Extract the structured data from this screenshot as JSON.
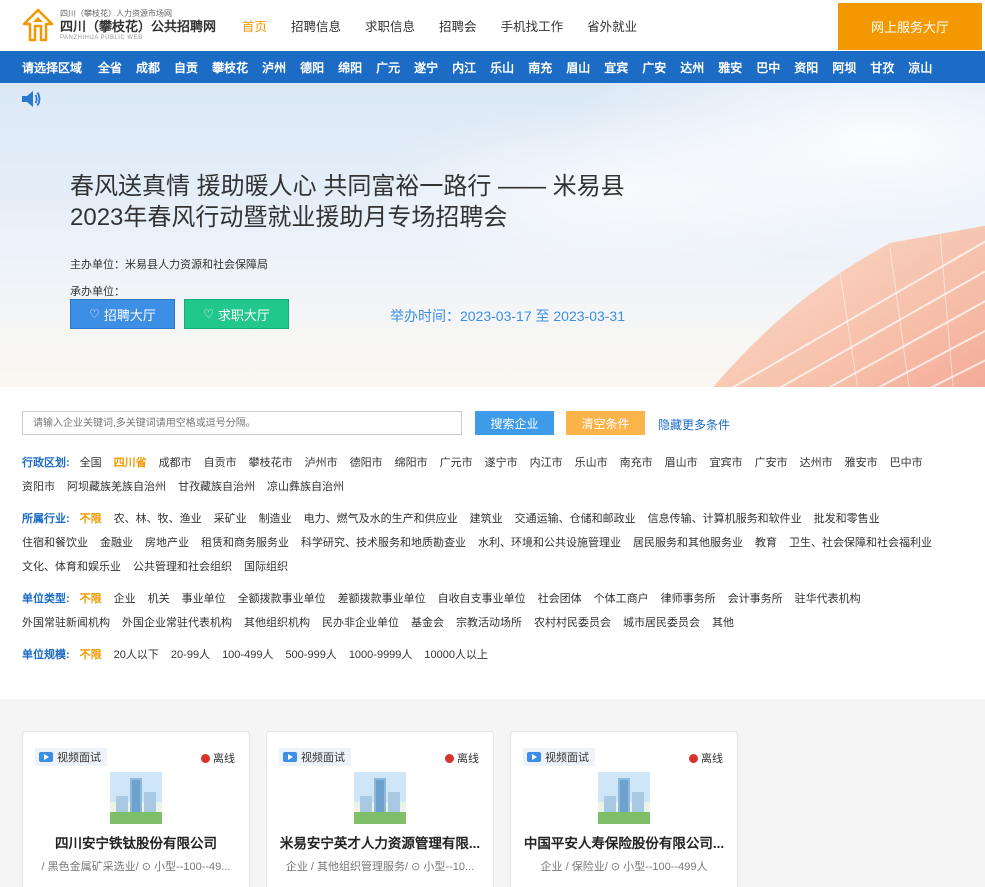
{
  "header": {
    "logo_small": "四川（攀枝花）人力资源市场网",
    "logo_main": "四川（攀枝花）公共招聘网",
    "logo_en": "PANZHIHUA PUBLIC WEB",
    "nav": [
      "首页",
      "招聘信息",
      "求职信息",
      "招聘会",
      "手机找工作",
      "省外就业"
    ],
    "hall_button": "网上服务大厅"
  },
  "regions": [
    "请选择区域",
    "全省",
    "成都",
    "自贡",
    "攀枝花",
    "泸州",
    "德阳",
    "绵阳",
    "广元",
    "遂宁",
    "内江",
    "乐山",
    "南充",
    "眉山",
    "宜宾",
    "广安",
    "达州",
    "雅安",
    "巴中",
    "资阳",
    "阿坝",
    "甘孜",
    "凉山"
  ],
  "banner": {
    "title_line1": "春风送真情 援助暖人心 共同富裕一路行 —— 米易县",
    "title_line2": "2023年春风行动暨就业援助月专场招聘会",
    "host": "主办单位：米易县人力资源和社会保障局",
    "cohost": "承办单位：",
    "recruit_hall": "招聘大厅",
    "job_hall": "求职大厅",
    "time": "举办时间：2023-03-17 至 2023-03-31"
  },
  "search": {
    "placeholder": "请输入企业关键词,多关键词请用空格或逗号分隔。",
    "search_button": "搜索企业",
    "clear_button": "清空条件",
    "more_link": "隐藏更多条件"
  },
  "filters": {
    "district": {
      "label": "行政区划:",
      "options": [
        "全国",
        "四川省",
        "成都市",
        "自贡市",
        "攀枝花市",
        "泸州市",
        "德阳市",
        "绵阳市",
        "广元市",
        "遂宁市",
        "内江市",
        "乐山市",
        "南充市",
        "眉山市",
        "宜宾市",
        "广安市",
        "达州市",
        "雅安市",
        "巴中市",
        "资阳市",
        "阿坝藏族羌族自治州",
        "甘孜藏族自治州",
        "凉山彝族自治州"
      ]
    },
    "industry": {
      "label": "所属行业:",
      "options": [
        "不限",
        "农、林、牧、渔业",
        "采矿业",
        "制造业",
        "电力、燃气及水的生产和供应业",
        "建筑业",
        "交通运输、仓储和邮政业",
        "信息传输、计算机服务和软件业",
        "批发和零售业",
        "住宿和餐饮业",
        "金融业",
        "房地产业",
        "租赁和商务服务业",
        "科学研究、技术服务和地质勘查业",
        "水利、环境和公共设施管理业",
        "居民服务和其他服务业",
        "教育",
        "卫生、社会保障和社会福利业",
        "文化、体育和娱乐业",
        "公共管理和社会组织",
        "国际组织"
      ]
    },
    "unit_type": {
      "label": "单位类型:",
      "options": [
        "不限",
        "企业",
        "机关",
        "事业单位",
        "全额拨款事业单位",
        "差额拨款事业单位",
        "自收自支事业单位",
        "社会团体",
        "个体工商户",
        "律师事务所",
        "会计事务所",
        "驻华代表机构",
        "外国常驻新闻机构",
        "外国企业常驻代表机构",
        "其他组织机构",
        "民办非企业单位",
        "基金会",
        "宗教活动场所",
        "农村村民委员会",
        "城市居民委员会",
        "其他"
      ]
    },
    "unit_size": {
      "label": "单位规模:",
      "options": [
        "不限",
        "20人以下",
        "20-99人",
        "100-499人",
        "500-999人",
        "1000-9999人",
        "10000人以上"
      ]
    }
  },
  "cards": [
    {
      "badge": "视频面试",
      "status": "离线",
      "name": "四川安宁铁钛股份有限公司",
      "meta": "/ 黑色金属矿采选业/ ⊙ 小型--100--49..."
    },
    {
      "badge": "视频面试",
      "status": "离线",
      "name": "米易安宁英才人力资源管理有限...",
      "meta": "企业 / 其他组织管理服务/ ⊙ 小型--10..."
    },
    {
      "badge": "视频面试",
      "status": "离线",
      "name": "中国平安人寿保险股份有限公司...",
      "meta": "企业 / 保险业/ ⊙ 小型--100--499人"
    }
  ]
}
